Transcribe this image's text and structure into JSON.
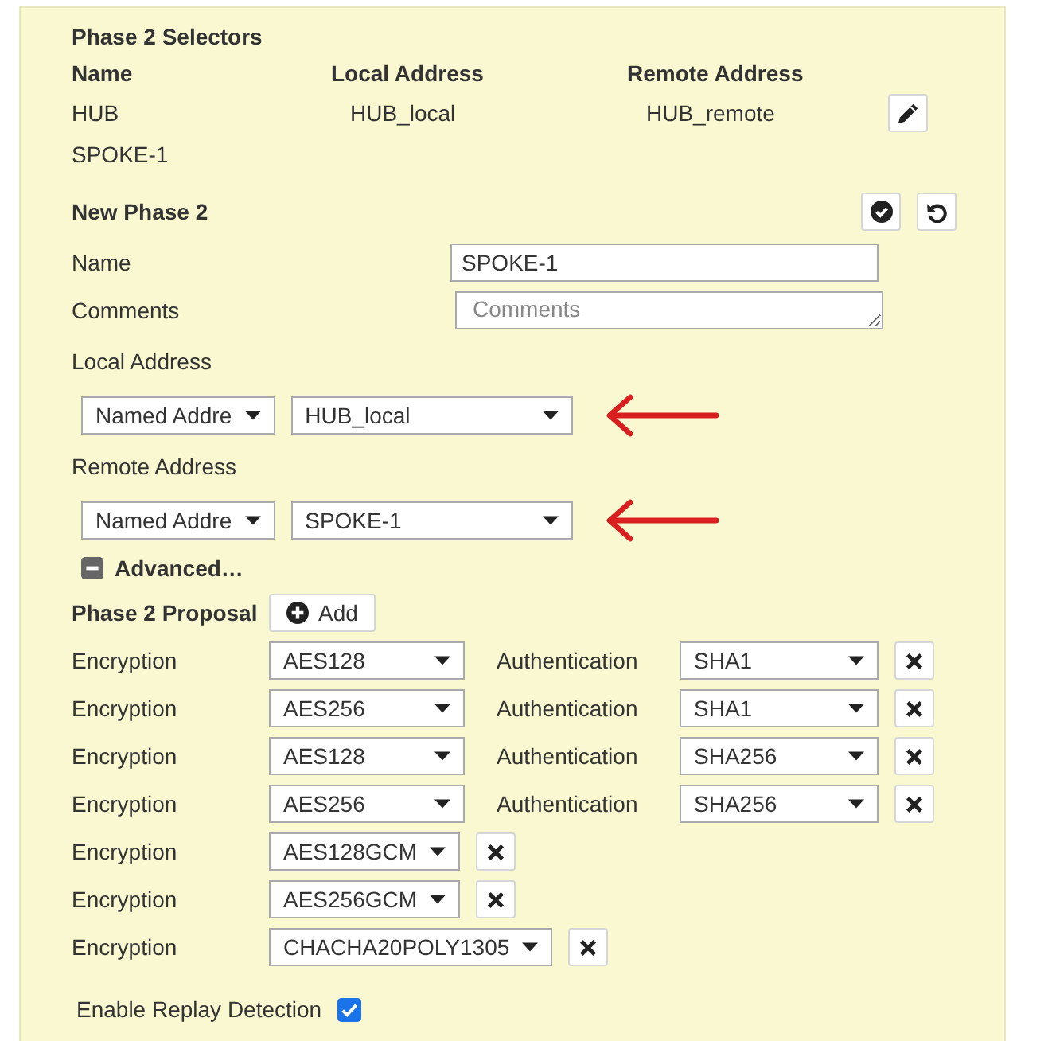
{
  "selectors": {
    "title": "Phase 2 Selectors",
    "columns": [
      "Name",
      "Local Address",
      "Remote Address"
    ],
    "rows": [
      {
        "kind": "saved",
        "name": "HUB",
        "local_address": "HUB_local",
        "remote_address": "HUB_remote"
      },
      {
        "kind": "editing",
        "name": "SPOKE-1"
      }
    ]
  },
  "new_phase2": {
    "title": "New Phase 2",
    "fields": [
      {
        "kind": "input",
        "label": "Name",
        "value": "SPOKE-1"
      },
      {
        "kind": "textarea",
        "label": "Comments",
        "placeholder": "Comments"
      }
    ],
    "addresses": [
      {
        "label": "Local Address",
        "type": "Named Addre",
        "value": "HUB_local",
        "arrow": true
      },
      {
        "label": "Remote Address",
        "type": "Named Addre",
        "value": "SPOKE-1",
        "arrow": true
      }
    ],
    "advanced": {
      "label": "Advanced…",
      "expanded": true
    },
    "proposal": {
      "label": "Phase 2 Proposal",
      "add_button": "Add",
      "rows": [
        {
          "kind": "pair",
          "encryption_label": "Encryption",
          "encryption": "AES128",
          "authentication_label": "Authentication",
          "authentication": "SHA1"
        },
        {
          "kind": "pair",
          "encryption_label": "Encryption",
          "encryption": "AES256",
          "authentication_label": "Authentication",
          "authentication": "SHA1"
        },
        {
          "kind": "pair",
          "encryption_label": "Encryption",
          "encryption": "AES128",
          "authentication_label": "Authentication",
          "authentication": "SHA256"
        },
        {
          "kind": "pair",
          "encryption_label": "Encryption",
          "encryption": "AES256",
          "authentication_label": "Authentication",
          "authentication": "SHA256"
        },
        {
          "kind": "single",
          "encryption_label": "Encryption",
          "encryption": "AES128GCM"
        },
        {
          "kind": "single",
          "encryption_label": "Encryption",
          "encryption": "AES256GCM"
        },
        {
          "kind": "single",
          "encryption_label": "Encryption",
          "encryption": "CHACHA20POLY1305"
        }
      ]
    },
    "replay_detection": {
      "label": "Enable Replay Detection",
      "checked": true
    }
  }
}
